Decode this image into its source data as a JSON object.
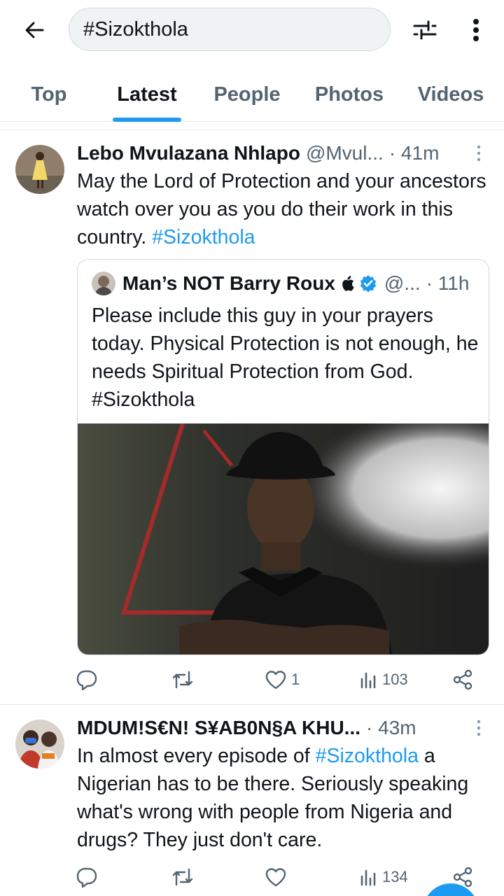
{
  "search": {
    "query": "#Sizokthola"
  },
  "tabs": [
    {
      "label": "Top"
    },
    {
      "label": "Latest"
    },
    {
      "label": "People"
    },
    {
      "label": "Photos"
    },
    {
      "label": "Videos"
    }
  ],
  "active_tab": "Latest",
  "tweets": [
    {
      "name": "Lebo Mvulazana Nhlapo",
      "handle": "@Mvul...",
      "time": "· 41m",
      "text_main": "May the Lord of Protection and your ancestors watch over you as you do their work in this country. ",
      "hashtag": "#Sizokthola",
      "quote": {
        "name": "Man’s NOT Barry Roux",
        "handle": "@...",
        "time": "· 11h",
        "text": "Please include this guy in your prayers today. Physical Protection is not enough, he needs Spiritual Protection from God. #Sizokthola"
      },
      "stats": {
        "likes": "1",
        "views": "103"
      }
    },
    {
      "name": "MDUM!S€N! S¥AB0N§A KHU...",
      "handle": "",
      "time": "· 43m",
      "text_pre": "In almost every episode of ",
      "hashtag": "#Sizokthola",
      "text_post": " a Nigerian has to be there. Seriously speaking what's wrong with people from Nigeria and drugs? They just don't care.",
      "stats": {
        "views": "134"
      }
    }
  ],
  "colors": {
    "accent": "#1d9bf0",
    "text": "#0f1419",
    "secondary": "#536471",
    "border": "#cfd9de"
  }
}
